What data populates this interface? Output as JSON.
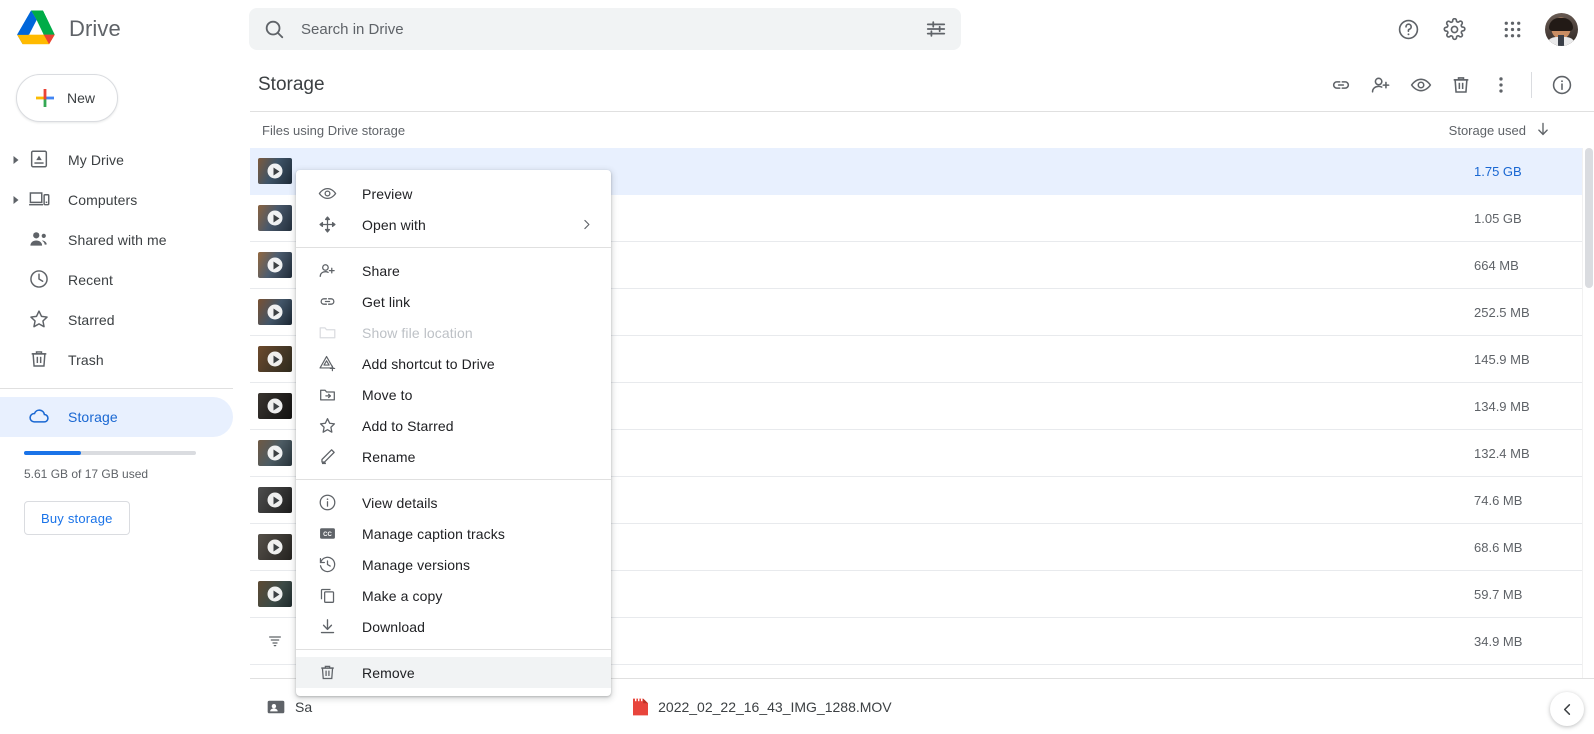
{
  "header": {
    "brand_name": "Drive",
    "logo_icon": "drive-logo",
    "search": {
      "placeholder": "Search in Drive",
      "value": "",
      "search_icon": "search-icon",
      "filter_icon": "tune-icon"
    },
    "help_icon": "help-circle-icon",
    "settings_icon": "gear-icon",
    "apps_icon": "apps-grid-icon",
    "avatar_icon": "user-avatar"
  },
  "sidebar": {
    "new_button": {
      "label": "New",
      "icon": "plus-icon"
    },
    "items": [
      {
        "label": "My Drive",
        "icon": "my-drive-icon",
        "expandable": true,
        "active": false
      },
      {
        "label": "Computers",
        "icon": "computer-icon",
        "expandable": true,
        "active": false
      },
      {
        "label": "Shared with me",
        "icon": "people-icon",
        "expandable": false,
        "active": false
      },
      {
        "label": "Recent",
        "icon": "clock-icon",
        "expandable": false,
        "active": false
      },
      {
        "label": "Starred",
        "icon": "star-icon",
        "expandable": false,
        "active": false
      },
      {
        "label": "Trash",
        "icon": "trash-icon",
        "expandable": false,
        "active": false
      },
      {
        "label": "Storage",
        "icon": "cloud-icon",
        "expandable": false,
        "active": true
      }
    ],
    "storage": {
      "used_percent": 33,
      "text": "5.61 GB of 17 GB used",
      "buy_label": "Buy storage",
      "bar_color": "#1a73e8"
    }
  },
  "main": {
    "title": "Storage",
    "toolbar_icons": [
      {
        "name": "get-link-icon"
      },
      {
        "name": "share-person-add-icon"
      },
      {
        "name": "preview-eye-icon"
      },
      {
        "name": "remove-trash-icon"
      },
      {
        "name": "more-vert-icon"
      },
      {
        "name": "details-info-icon"
      }
    ],
    "list_header": {
      "name_column": "Files using Drive storage",
      "size_column": "Storage used",
      "sort_icon": "arrow-down-icon"
    },
    "rows": [
      {
        "size": "1.75 GB",
        "selected": true,
        "thumb": "video-thumbnail",
        "thumb_color": "linear-gradient(115deg,#7d5a3c 0%,#3f5468 45%,#1e2b38 100%)"
      },
      {
        "size": "1.05 GB",
        "selected": false,
        "thumb": "video-thumbnail",
        "thumb_color": "linear-gradient(115deg,#8a6340 0%,#49586b 45%,#232f3c 100%)"
      },
      {
        "size": "664 MB",
        "selected": false,
        "thumb": "video-thumbnail",
        "thumb_color": "linear-gradient(115deg,#93683f 0%,#4d5d70 45%,#202c39 100%)"
      },
      {
        "size": "252.5 MB",
        "selected": false,
        "thumb": "video-thumbnail",
        "thumb_color": "linear-gradient(120deg,#7a5132 0%,#425568 50%,#1b2733 100%)"
      },
      {
        "size": "145.9 MB",
        "selected": false,
        "thumb": "video-thumbnail",
        "thumb_color": "linear-gradient(120deg,#6d4a2c 0%,#4a3a28 50%,#2f2a1c 100%)"
      },
      {
        "size": "134.9 MB",
        "selected": false,
        "thumb": "video-thumbnail",
        "thumb_color": "linear-gradient(120deg,#3a3530 0%,#22201e 55%,#131211 100%)"
      },
      {
        "size": "132.4 MB",
        "selected": false,
        "thumb": "video-thumbnail",
        "thumb_color": "linear-gradient(120deg,#6f5a44 0%,#4c5b63 50%,#27333a 100%)"
      },
      {
        "size": "74.6 MB",
        "selected": false,
        "thumb": "video-thumbnail",
        "thumb_color": "linear-gradient(120deg,#4d4d4d 0%,#333333 55%,#1c1c1c 100%)"
      },
      {
        "size": "68.6 MB",
        "selected": false,
        "thumb": "video-thumbnail",
        "thumb_color": "linear-gradient(120deg,#555049 0%,#3a3733 55%,#24221f 100%)"
      },
      {
        "size": "59.7 MB",
        "selected": false,
        "thumb": "video-thumbnail",
        "thumb_color": "linear-gradient(120deg,#5d4a33 0%,#3c4a46 55%,#1f2a2c 100%)"
      },
      {
        "size": "34.9 MB",
        "selected": false,
        "thumb": "sort-glyph",
        "thumb_color": "none"
      }
    ]
  },
  "bottom_bar": {
    "left_label": "Sa",
    "left_icon": "contact-card-icon",
    "file_label": "2022_02_22_16_43_IMG_1288.MOV",
    "file_icon": "mov-video-file-icon",
    "collapse_icon": "chevron-left-icon"
  },
  "context_menu": {
    "groups": [
      [
        {
          "label": "Preview",
          "icon": "preview-eye-icon",
          "disabled": false,
          "submenu": false,
          "highlight": false
        },
        {
          "label": "Open with",
          "icon": "open-with-icon",
          "disabled": false,
          "submenu": true,
          "highlight": false
        }
      ],
      [
        {
          "label": "Share",
          "icon": "share-person-add-icon",
          "disabled": false,
          "submenu": false,
          "highlight": false
        },
        {
          "label": "Get link",
          "icon": "get-link-icon",
          "disabled": false,
          "submenu": false,
          "highlight": false
        },
        {
          "label": "Show file location",
          "icon": "folder-icon",
          "disabled": true,
          "submenu": false,
          "highlight": false
        },
        {
          "label": "Add shortcut to Drive",
          "icon": "add-shortcut-icon",
          "disabled": false,
          "submenu": false,
          "highlight": false
        },
        {
          "label": "Move to",
          "icon": "move-to-folder-icon",
          "disabled": false,
          "submenu": false,
          "highlight": false
        },
        {
          "label": "Add to Starred",
          "icon": "star-icon",
          "disabled": false,
          "submenu": false,
          "highlight": false
        },
        {
          "label": "Rename",
          "icon": "pencil-icon",
          "disabled": false,
          "submenu": false,
          "highlight": false
        }
      ],
      [
        {
          "label": "View details",
          "icon": "details-info-icon",
          "disabled": false,
          "submenu": false,
          "highlight": false
        },
        {
          "label": "Manage caption tracks",
          "icon": "closed-caption-icon",
          "disabled": false,
          "submenu": false,
          "highlight": false
        },
        {
          "label": "Manage versions",
          "icon": "history-icon",
          "disabled": false,
          "submenu": false,
          "highlight": false
        },
        {
          "label": "Make a copy",
          "icon": "copy-icon",
          "disabled": false,
          "submenu": false,
          "highlight": false
        },
        {
          "label": "Download",
          "icon": "download-icon",
          "disabled": false,
          "submenu": false,
          "highlight": false
        }
      ],
      [
        {
          "label": "Remove",
          "icon": "remove-trash-icon",
          "disabled": false,
          "submenu": false,
          "highlight": true
        }
      ]
    ]
  }
}
